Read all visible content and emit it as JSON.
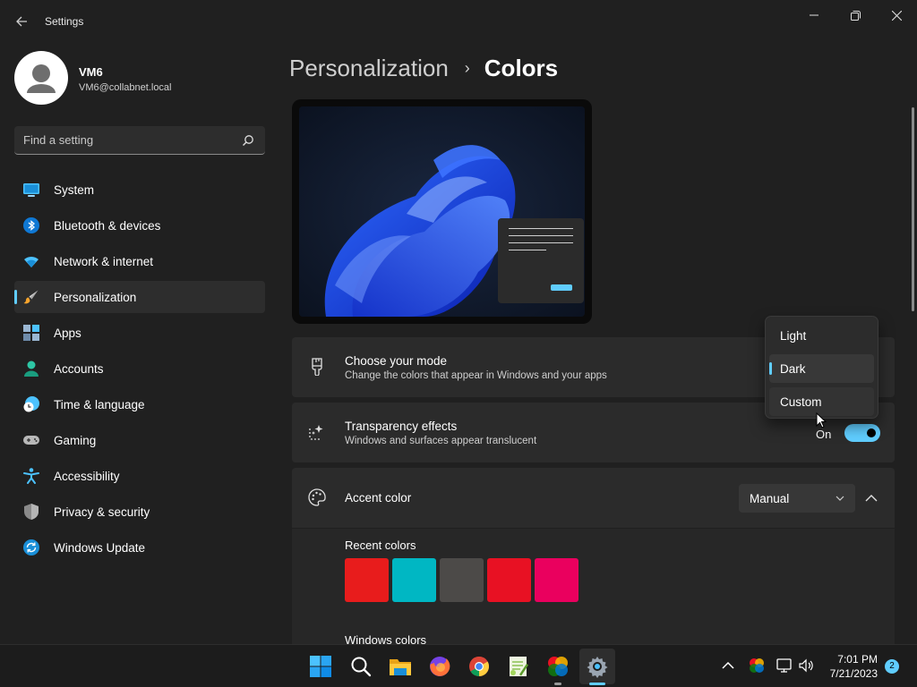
{
  "app": {
    "title": "Settings",
    "back_icon": "back-arrow-icon"
  },
  "window_controls": {
    "minimize": "minimize-icon",
    "maximize": "maximize-icon",
    "close": "close-icon"
  },
  "user": {
    "name": "VM6",
    "email": "VM6@collabnet.local"
  },
  "search": {
    "placeholder": "Find a setting",
    "value": ""
  },
  "sidebar": {
    "items": [
      {
        "label": "System",
        "icon": "system-icon"
      },
      {
        "label": "Bluetooth & devices",
        "icon": "bluetooth-icon"
      },
      {
        "label": "Network & internet",
        "icon": "wifi-icon"
      },
      {
        "label": "Personalization",
        "icon": "brush-icon",
        "active": true
      },
      {
        "label": "Apps",
        "icon": "apps-icon"
      },
      {
        "label": "Accounts",
        "icon": "accounts-icon"
      },
      {
        "label": "Time & language",
        "icon": "clock-globe-icon"
      },
      {
        "label": "Gaming",
        "icon": "gamepad-icon"
      },
      {
        "label": "Accessibility",
        "icon": "accessibility-icon"
      },
      {
        "label": "Privacy & security",
        "icon": "shield-icon"
      },
      {
        "label": "Windows Update",
        "icon": "update-icon"
      }
    ]
  },
  "breadcrumb": {
    "parent": "Personalization",
    "separator": "›",
    "current": "Colors"
  },
  "mode": {
    "title": "Choose your mode",
    "subtitle": "Change the colors that appear in Windows and your apps",
    "options": [
      "Light",
      "Dark",
      "Custom"
    ],
    "selected": "Dark",
    "hovered": "Custom"
  },
  "transparency": {
    "title": "Transparency effects",
    "subtitle": "Windows and surfaces appear translucent",
    "state_label": "On",
    "on": true
  },
  "accent": {
    "title": "Accent color",
    "mode_value": "Manual",
    "recent_label": "Recent colors",
    "recent_colors": [
      "#e81c1c",
      "#00b7c3",
      "#4c4a48",
      "#e81123",
      "#ea005e"
    ],
    "windows_label": "Windows colors"
  },
  "colors": {
    "accent": "#60cdff",
    "background": "#202020",
    "card": "#2b2b2b"
  },
  "taskbar": {
    "apps": [
      "start-icon",
      "search-icon",
      "file-explorer-icon",
      "firefox-icon",
      "chrome-icon",
      "notepad-plus-icon",
      "color-app-icon",
      "settings-icon"
    ],
    "tray": [
      "chevron-up-icon",
      "color-tray-icon",
      "network-icon",
      "volume-icon"
    ],
    "time": "7:01 PM",
    "date": "7/21/2023",
    "notification_count": "2"
  }
}
